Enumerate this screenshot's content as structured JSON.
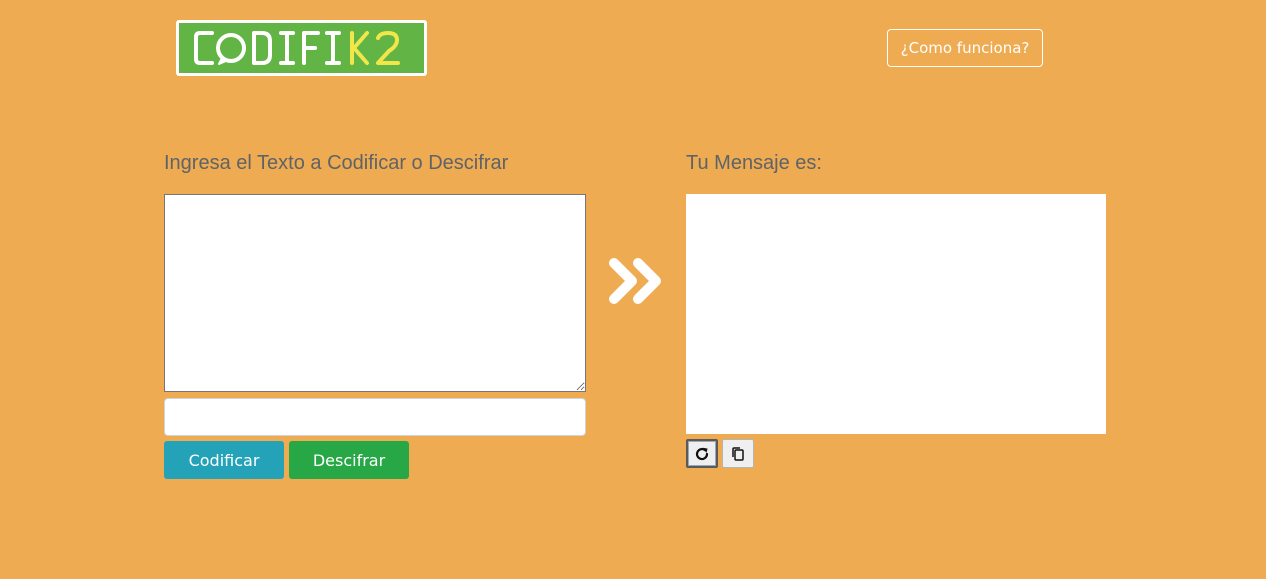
{
  "header": {
    "logo_text": "CODIFIK2",
    "how_it_works_label": "¿Como funciona?"
  },
  "encoder": {
    "heading": "Ingresa el Texto a Codificar o Descifrar",
    "text_value": "",
    "key_value": "",
    "encode_label": "Codificar",
    "decode_label": "Descifrar"
  },
  "output": {
    "heading": "Tu Mensaje es:",
    "message": ""
  },
  "icons": {
    "arrow": "double-chevron-right-icon",
    "reset": "refresh-icon",
    "copy": "copy-icon"
  },
  "colors": {
    "background": "#EEAB51",
    "logo_green": "#62B444",
    "logo_accent": "#F1E74A",
    "encode_button": "#23A2B8",
    "decode_button": "#27A745",
    "heading_text": "#5f6368"
  }
}
